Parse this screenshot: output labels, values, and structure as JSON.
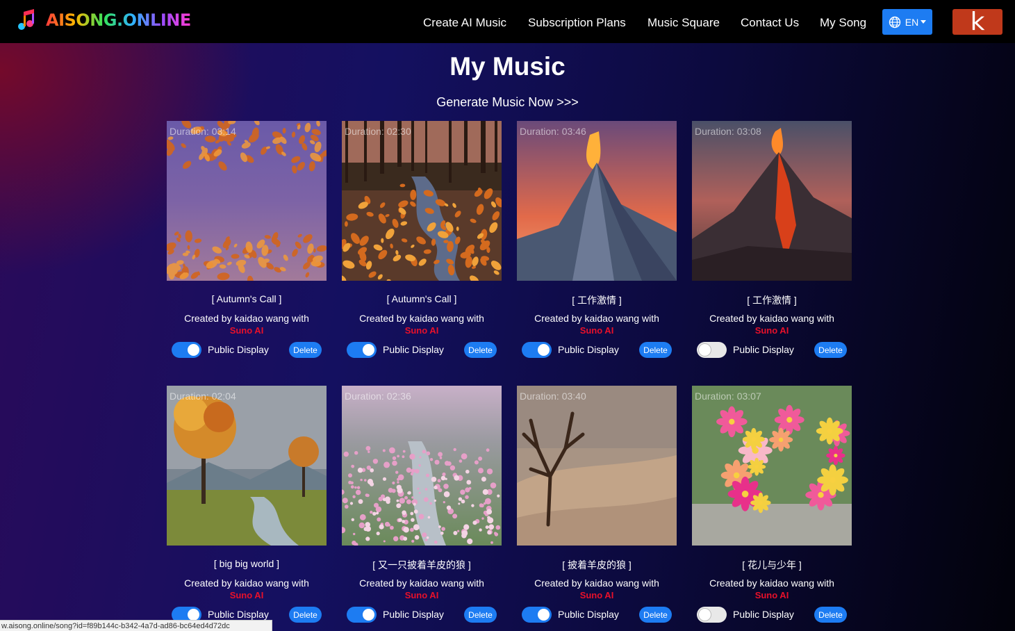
{
  "header": {
    "logo_text": "AISONG.ONLINE",
    "nav": [
      "Create AI Music",
      "Subscription Plans",
      "Music Square",
      "Contact Us",
      "My Song"
    ],
    "language": "EN",
    "avatar_letter": "k"
  },
  "main": {
    "title": "My Music",
    "generate_link": "Generate Music Now >>>"
  },
  "songs": [
    {
      "title": "[ Autumn's Call ]",
      "duration": "Duration: 03:14",
      "created_by": "Created by kaidao wang with",
      "tool": "Suno AI",
      "public_label": "Public Display",
      "public": true,
      "delete_label": "Delete",
      "art": "autumn-sky"
    },
    {
      "title": "[ Autumn's Call ]",
      "duration": "Duration: 02:30",
      "created_by": "Created by kaidao wang with",
      "tool": "Suno AI",
      "public_label": "Public Display",
      "public": true,
      "delete_label": "Delete",
      "art": "autumn-river"
    },
    {
      "title": "[ 工作激情 ]",
      "duration": "Duration: 03:46",
      "created_by": "Created by kaidao wang with",
      "tool": "Suno AI",
      "public_label": "Public Display",
      "public": true,
      "delete_label": "Delete",
      "art": "volcano-painted"
    },
    {
      "title": "[ 工作激情 ]",
      "duration": "Duration: 03:08",
      "created_by": "Created by kaidao wang with",
      "tool": "Suno AI",
      "public_label": "Public Display",
      "public": false,
      "delete_label": "Delete",
      "art": "volcano-dark"
    },
    {
      "title": "[ big big world ]",
      "duration": "Duration: 02:04",
      "created_by": "Created by kaidao wang with",
      "tool": "Suno AI",
      "public_label": "Public Display",
      "public": true,
      "delete_label": "Delete",
      "art": "autumn-landscape"
    },
    {
      "title": "[ 又一只披着羊皮的狼 ]",
      "duration": "Duration: 02:36",
      "created_by": "Created by kaidao wang with",
      "tool": "Suno AI",
      "public_label": "Public Display",
      "public": true,
      "delete_label": "Delete",
      "art": "flower-field"
    },
    {
      "title": "[ 披着羊皮的狼 ]",
      "duration": "Duration: 03:40",
      "created_by": "Created by kaidao wang with",
      "tool": "Suno AI",
      "public_label": "Public Display",
      "public": true,
      "delete_label": "Delete",
      "art": "desert-tree"
    },
    {
      "title": "[ 花儿与少年 ]",
      "duration": "Duration: 03:07",
      "created_by": "Created by kaidao wang with",
      "tool": "Suno AI",
      "public_label": "Public Display",
      "public": false,
      "delete_label": "Delete",
      "art": "flower-bouquet"
    }
  ],
  "status_url": "w.aisong.online/song?id=f89b144c-b342-4a7d-ad86-bc64ed4d72dc"
}
